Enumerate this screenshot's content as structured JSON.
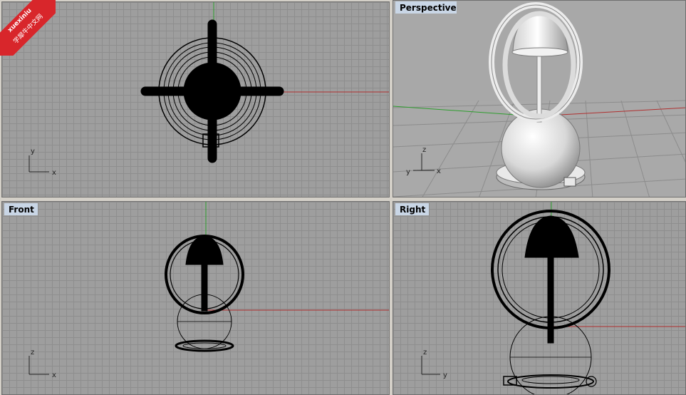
{
  "watermark": {
    "line1": "xuexiniu",
    "line2": "学犀牛中文网"
  },
  "viewports": {
    "top": {
      "label": "",
      "axis_a": "y",
      "axis_b": "x"
    },
    "perspective": {
      "label": "Perspective",
      "axis_a": "z",
      "axis_b": "x",
      "axis_c": "y"
    },
    "front": {
      "label": "Front",
      "axis_a": "z",
      "axis_b": "x"
    },
    "right": {
      "label": "Right",
      "axis_a": "z",
      "axis_b": "y"
    }
  },
  "colors": {
    "grid_bg": "#9e9e9e",
    "x_axis": "#b03030",
    "y_axis": "#2e9e2e",
    "label_bg": "#c9d6e6"
  }
}
